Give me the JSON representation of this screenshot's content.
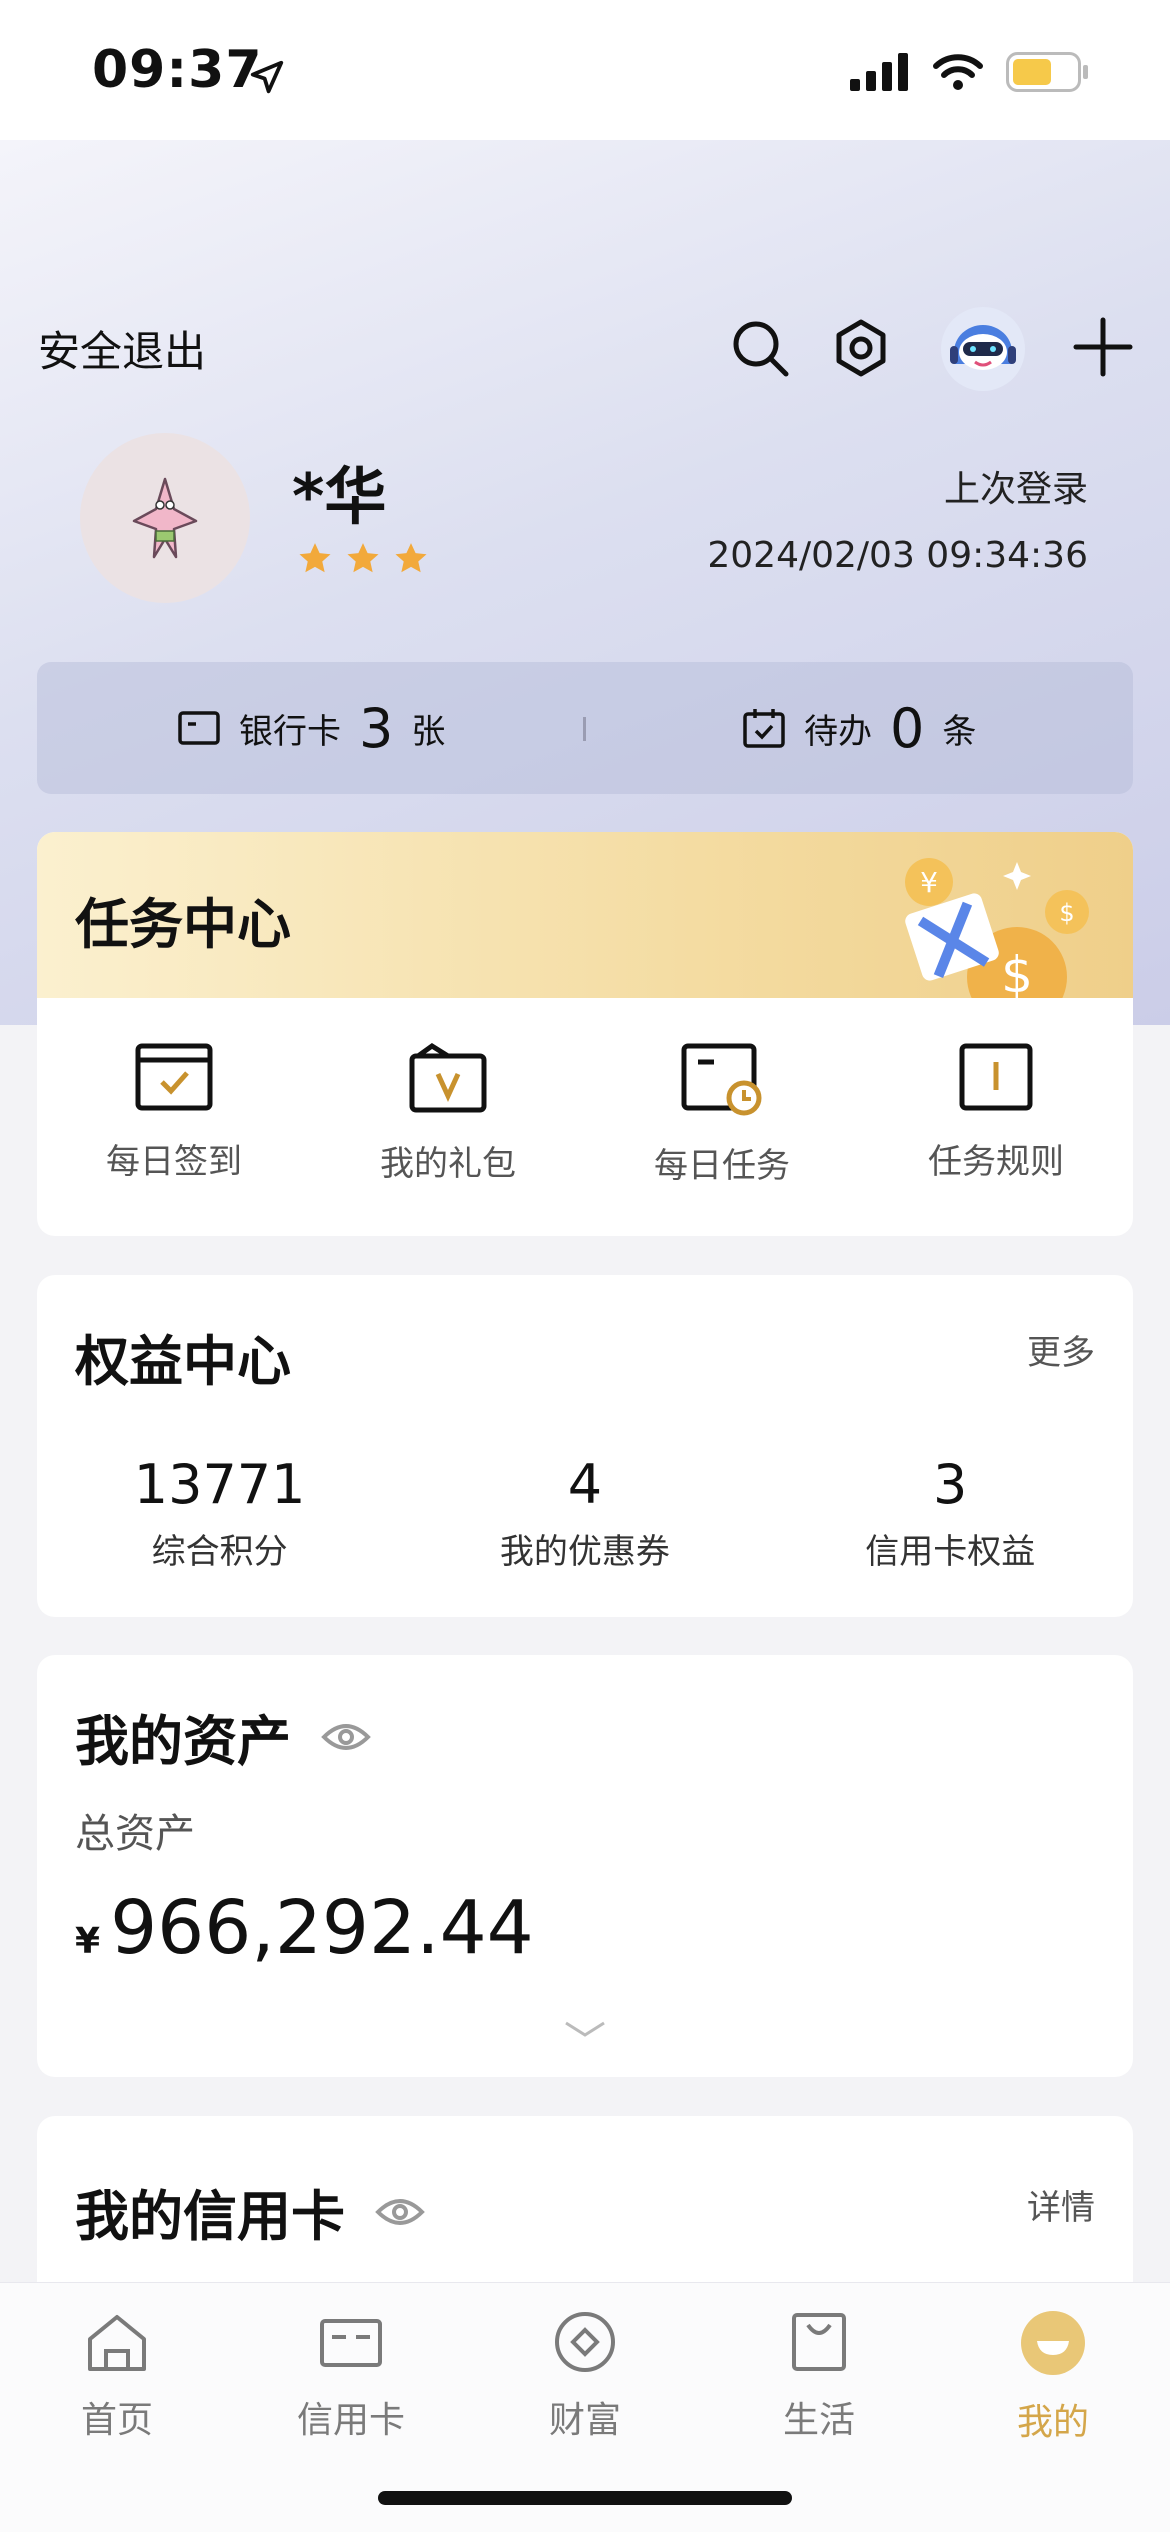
{
  "status_bar": {
    "time": "09:37"
  },
  "header": {
    "logout_label": "安全退出"
  },
  "profile": {
    "name": "*华",
    "stars": 3,
    "last_login_label": "上次登录",
    "last_login_time": "2024/02/03 09:34:36"
  },
  "summary": {
    "bank_card_label": "银行卡",
    "bank_card_count": "3",
    "bank_card_unit": "张",
    "todo_label": "待办",
    "todo_count": "0",
    "todo_unit": "条"
  },
  "task_center": {
    "title": "任务中心",
    "items": [
      {
        "label": "每日签到",
        "icon": "calendar-check-icon"
      },
      {
        "label": "我的礼包",
        "icon": "gift-pack-icon"
      },
      {
        "label": "每日任务",
        "icon": "task-clock-icon"
      },
      {
        "label": "任务规则",
        "icon": "rule-book-icon"
      }
    ]
  },
  "equity_center": {
    "title": "权益中心",
    "more_label": "更多",
    "items": [
      {
        "value": "13771",
        "label": "综合积分"
      },
      {
        "value": "4",
        "label": "我的优惠券"
      },
      {
        "value": "3",
        "label": "信用卡权益"
      }
    ]
  },
  "assets": {
    "title": "我的资产",
    "total_label": "总资产",
    "currency": "¥",
    "total_value": "966,292.44"
  },
  "credit_card": {
    "title": "我的信用卡",
    "detail_label": "详情"
  },
  "tab_bar": {
    "items": [
      {
        "label": "首页",
        "icon": "home-icon"
      },
      {
        "label": "信用卡",
        "icon": "credit-card-icon"
      },
      {
        "label": "财富",
        "icon": "wealth-icon"
      },
      {
        "label": "生活",
        "icon": "shopping-bag-icon"
      },
      {
        "label": "我的",
        "icon": "profile-icon"
      }
    ],
    "active_index": 4
  },
  "colors": {
    "accent_gold": "#c8922e",
    "tab_active": "#d4a64a",
    "star": "#f2a93b"
  }
}
